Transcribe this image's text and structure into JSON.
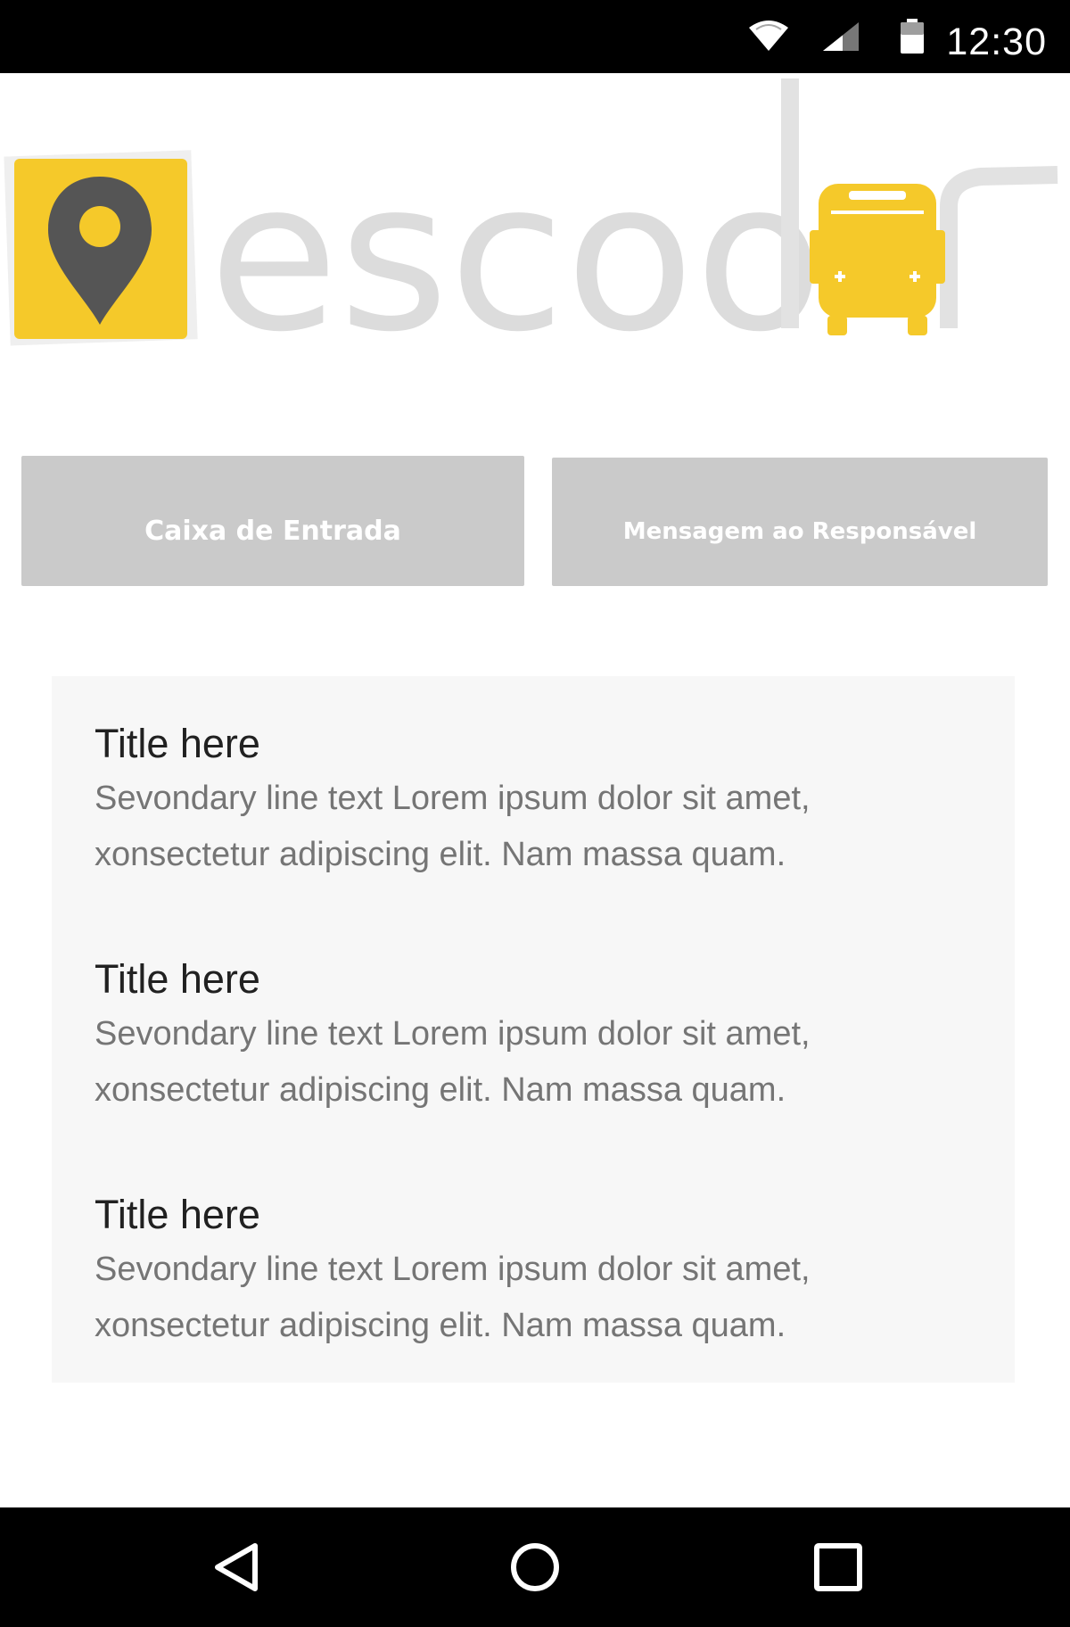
{
  "status_bar": {
    "time": "12:30",
    "icons": [
      "wifi-icon",
      "cell-signal-icon",
      "battery-icon"
    ]
  },
  "logo": {
    "text": "escolar",
    "brand_color": "#f5c92a",
    "pin_color": "#555555",
    "wordmark_color": "#dcdcdc"
  },
  "buttons": {
    "inbox_label": "Caixa de Entrada",
    "message_label": "Mensagem ao Responsável"
  },
  "messages": [
    {
      "title": "Title here",
      "line1": "Sevondary line text Lorem ipsum dolor sit amet,",
      "line2": "xonsectetur adipiscing elit. Nam massa quam."
    },
    {
      "title": "Title here",
      "line1": "Sevondary line text Lorem ipsum dolor sit amet,",
      "line2": "xonsectetur adipiscing elit. Nam massa quam."
    },
    {
      "title": "Title here",
      "line1": "Sevondary line text Lorem ipsum dolor sit amet,",
      "line2": "xonsectetur adipiscing elit. Nam massa quam."
    }
  ],
  "nav_bar": {
    "icons": [
      "back-icon",
      "home-icon",
      "recents-icon"
    ]
  },
  "colors": {
    "button_bg": "#cacaca",
    "list_bg": "#f7f7f7",
    "title_text": "#212121",
    "secondary_text": "#757575"
  }
}
